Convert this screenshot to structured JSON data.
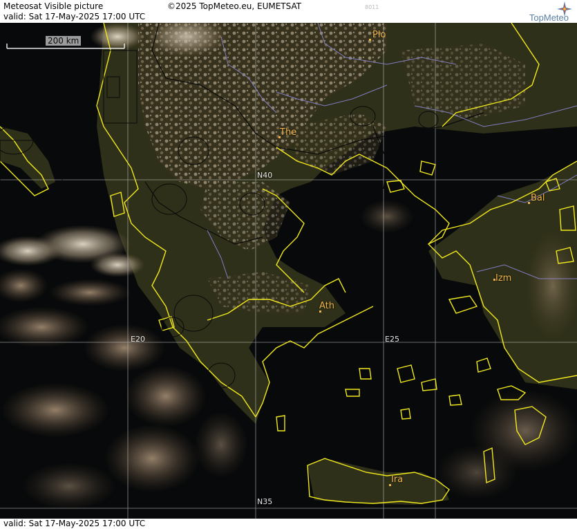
{
  "header": {
    "title": "Meteosat Visible picture",
    "valid": "valid:  Sat  17-May-2025  17:00 UTC",
    "copyright": "©2025 TopMeteo.eu, EUMETSAT",
    "code": "8011",
    "logo_text": "TopMeteo"
  },
  "map": {
    "scale_label": "200 km",
    "grid_labels": {
      "lat40": "N40",
      "lat35": "N35",
      "lon20": "E20",
      "lon25": "E25"
    },
    "cities": {
      "plovdiv": "Plo",
      "thessaloniki": "The",
      "athens": "Ath",
      "balikesir": "Bal",
      "izmir": "Izm",
      "iraklion": "Ira"
    },
    "colors": {
      "coast": "#f2ea1c",
      "rivers": "#8a87d8",
      "grid": "#c9c9c9",
      "city": "#f0b44a",
      "sea": "#07090a",
      "land": "#3a3820",
      "cloud": "#cfc3b2"
    }
  },
  "footer": {
    "valid": "valid:  Sat  17-May-2025  17:00 UTC"
  }
}
